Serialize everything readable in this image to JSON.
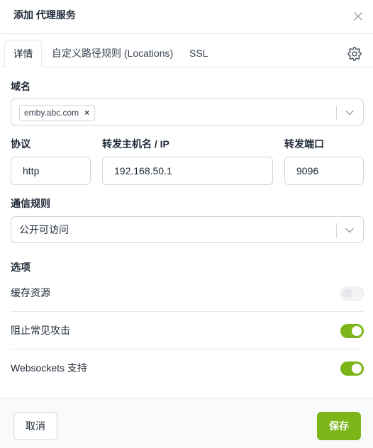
{
  "dialog": {
    "title": "添加 代理服务"
  },
  "tabs": [
    {
      "label": "详情"
    },
    {
      "label": "自定义路径规则 (Locations)"
    },
    {
      "label": "SSL"
    }
  ],
  "domain": {
    "label": "域名",
    "chips": [
      "emby.abc.com"
    ],
    "chip_remove": "×"
  },
  "protocol": {
    "label": "协议",
    "value": "http"
  },
  "forward_host": {
    "label": "转发主机名 / IP",
    "value": "192.168.50.1"
  },
  "forward_port": {
    "label": "转发端口",
    "value": "9096"
  },
  "access": {
    "label": "通信规则",
    "value": "公开可访问"
  },
  "options": {
    "heading": "选项",
    "items": [
      {
        "label": "缓存资源",
        "enabled": false
      },
      {
        "label": "阻止常见攻击",
        "enabled": true
      },
      {
        "label": "Websockets 支持",
        "enabled": true
      }
    ]
  },
  "footer": {
    "cancel_label": "取消",
    "save_label": "保存"
  },
  "colors": {
    "accent": "#7cb518",
    "border": "#d1d5db"
  },
  "icons": {
    "close": "close-icon",
    "settings": "gear-icon",
    "dropdown": "chevron-down-icon"
  }
}
